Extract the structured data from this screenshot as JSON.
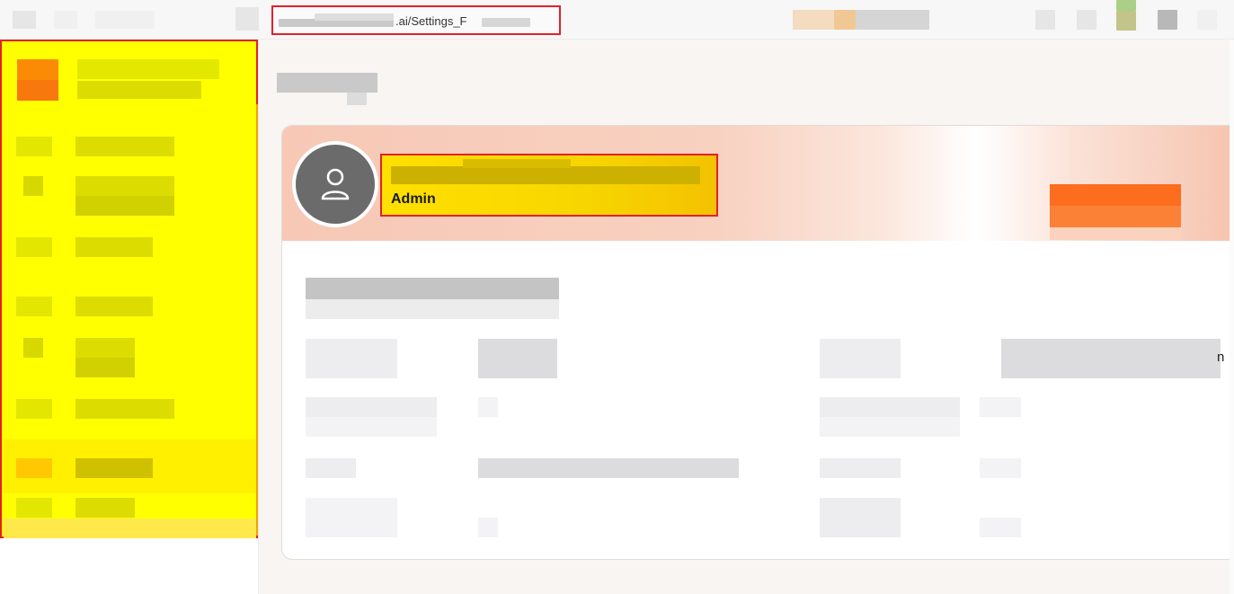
{
  "browser": {
    "url_visible_text": ".ai/Settings_F"
  },
  "profile": {
    "role": "Admin"
  },
  "table": {
    "edge_fragment": "n"
  },
  "colors": {
    "sidebar_highlight": "#ffff00",
    "annotation_border": "#e2202a",
    "accent_orange": "#fc6d1e",
    "banner_peach": "#f7c8b6",
    "avatar_gray": "#6b6b6b"
  }
}
